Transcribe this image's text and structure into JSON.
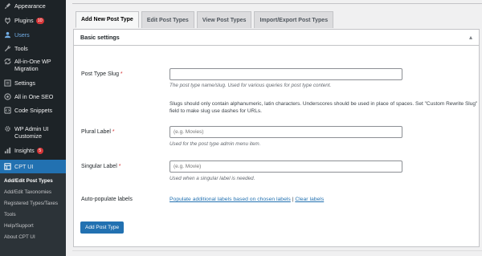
{
  "sidebar": {
    "items": [
      {
        "label": "Appearance",
        "icon": "paintbrush-icon"
      },
      {
        "label": "Plugins",
        "icon": "plug-icon",
        "badge": "10"
      },
      {
        "label": "Users",
        "icon": "users-icon"
      },
      {
        "label": "Tools",
        "icon": "wrench-icon"
      },
      {
        "label": "All-in-One WP Migration",
        "icon": "migration-icon"
      },
      {
        "label": "Settings",
        "icon": "settings-icon"
      },
      {
        "label": "All in One SEO",
        "icon": "seo-icon"
      },
      {
        "label": "Code Snippets",
        "icon": "code-snippets-icon"
      },
      {
        "label": "WP Admin UI Customize",
        "icon": "gear-icon"
      },
      {
        "label": "Insights",
        "icon": "insights-icon",
        "badge": "5"
      },
      {
        "label": "CPT UI",
        "icon": "cpt-ui-icon"
      }
    ],
    "submenu": [
      "Add/Edit Post Types",
      "Add/Edit Taxonomies",
      "Registered Types/Taxes",
      "Tools",
      "Help/Support",
      "About CPT UI"
    ]
  },
  "tabs": [
    "Add New Post Type",
    "Edit Post Types",
    "View Post Types",
    "Import/Export Post Types"
  ],
  "panel": {
    "title": "Basic settings",
    "slug_label": "Post Type Slug",
    "slug_help": "The post type name/slug. Used for various queries for post type content.",
    "slug_note": "Slugs should only contain alphanumeric, latin characters. Underscores should be used in place of spaces. Set \"Custom Rewrite Slug\" field to make slug use dashes for URLs.",
    "plural_label": "Plural Label",
    "plural_placeholder": "(e.g. Movies)",
    "plural_help": "Used for the post type admin menu item.",
    "singular_label": "Singular Label",
    "singular_placeholder": "(e.g. Movie)",
    "singular_help": "Used when a singular label is needed.",
    "autopopulate_label": "Auto-populate labels",
    "populate_link": "Populate additional labels based on chosen labels",
    "separator": "|",
    "clear_link": "Clear labels",
    "required_mark": "*",
    "submit": "Add Post Type"
  },
  "colors": {
    "sidebar_bg": "#1d2327",
    "accent": "#2271b1",
    "badge": "#d63638"
  }
}
